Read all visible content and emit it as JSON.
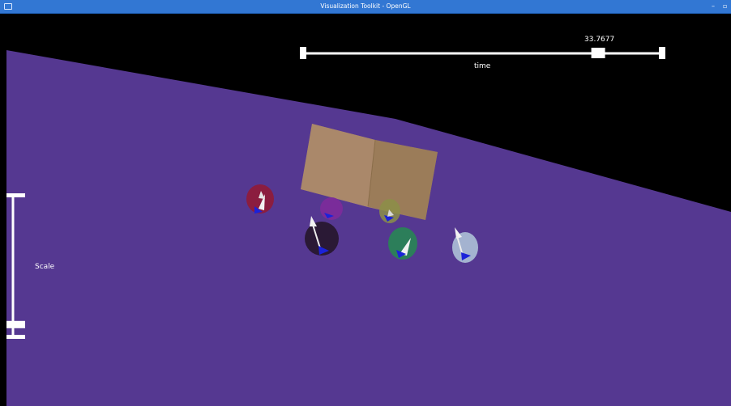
{
  "window": {
    "title": "Visualization Toolkit - OpenGL",
    "minimize_glyph": "–",
    "restore_glyph": "▫"
  },
  "time_slider": {
    "title": "time",
    "value_label": "33.7677",
    "value_fraction": 0.82
  },
  "scale_slider": {
    "title": "Scale",
    "value_fraction": 0.09
  },
  "colors": {
    "background": "#000000",
    "ground_plane": "#553891",
    "box": "#a88864",
    "arrow_tip": "#1b22d9",
    "slider": "#ffffff",
    "titlebar": "#3277d3"
  },
  "scene": {
    "objects": [
      "ground-plane",
      "translucent-box",
      "particle-crimson",
      "particle-magenta",
      "particle-dark",
      "particle-olive",
      "particle-green",
      "particle-lightblue"
    ]
  }
}
